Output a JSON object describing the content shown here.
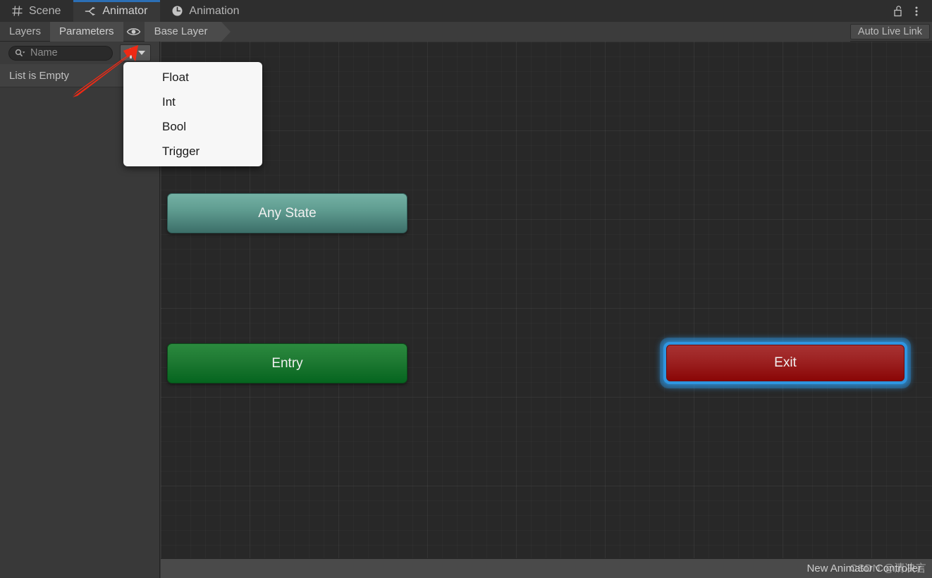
{
  "window": {
    "tabs": [
      {
        "label": "Scene",
        "icon": "grid-icon",
        "active": false
      },
      {
        "label": "Animator",
        "icon": "animator-branch-icon",
        "active": true
      },
      {
        "label": "Animation",
        "icon": "clock-icon",
        "active": false
      }
    ],
    "lock_icon": "unlocked-padlock-icon",
    "menu_icon": "kebab-menu-icon"
  },
  "toolbar": {
    "layers_label": "Layers",
    "parameters_label": "Parameters",
    "eye_icon": "eye-icon",
    "breadcrumb_label": "Base Layer",
    "live_link_label": "Auto Live Link"
  },
  "parameters_panel": {
    "search": {
      "value": "",
      "placeholder": "Name",
      "icon": "search-icon"
    },
    "add_button": {
      "plus_icon": "plus-icon",
      "caret_icon": "chevron-down-icon"
    },
    "empty_label": "List is Empty"
  },
  "add_parameter_menu": {
    "visible": true,
    "items": [
      {
        "label": "Float"
      },
      {
        "label": "Int"
      },
      {
        "label": "Bool"
      },
      {
        "label": "Trigger"
      }
    ]
  },
  "graph": {
    "nodes": [
      {
        "id": "any-state",
        "label": "Any State",
        "color": "#5f9c90",
        "selected": false
      },
      {
        "id": "entry",
        "label": "Entry",
        "color": "#1f7a33",
        "selected": false
      },
      {
        "id": "exit",
        "label": "Exit",
        "color": "#9e2424",
        "selected": true,
        "selection_color": "#2f95e0"
      }
    ]
  },
  "status_bar": {
    "controller_name": "New Animator Controller"
  },
  "annotations": {
    "arrow_color": "#ef2a15",
    "watermark_text": "CSDN @清决言"
  }
}
